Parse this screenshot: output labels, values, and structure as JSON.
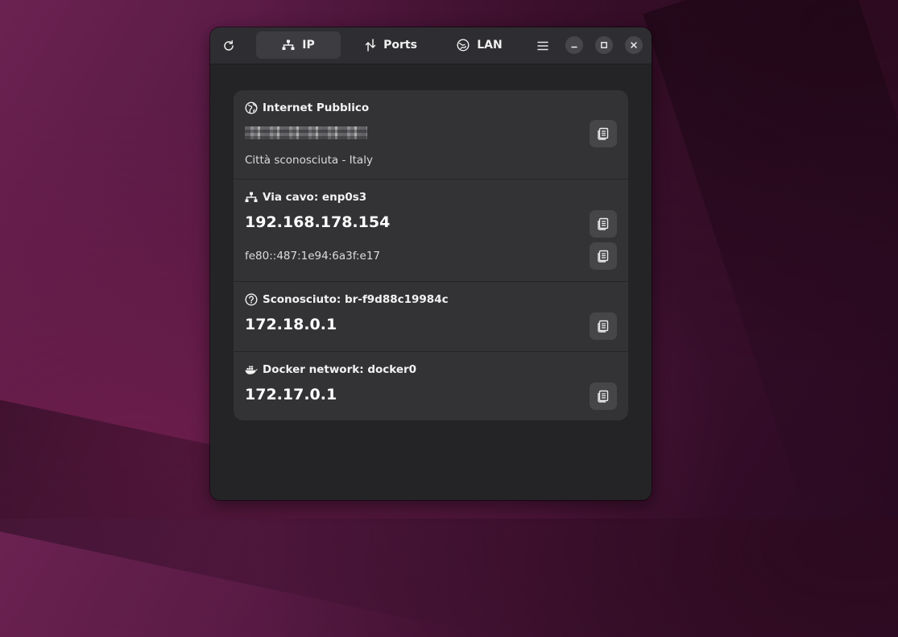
{
  "header": {
    "tabs": [
      {
        "label": "IP",
        "icon": "network-wired-icon",
        "active": true
      },
      {
        "label": "Ports",
        "icon": "ports-arrows-icon",
        "active": false
      },
      {
        "label": "LAN",
        "icon": "lan-globe-icon",
        "active": false
      }
    ]
  },
  "interfaces": [
    {
      "title": "Internet Pubblico",
      "icon": "globe-icon",
      "primary": "",
      "primary_redacted": true,
      "secondary": "Città sconosciuta - Italy"
    },
    {
      "title": "Via cavo: enp0s3",
      "icon": "network-wired-icon",
      "primary": "192.168.178.154",
      "secondary": "fe80::487:1e94:6a3f:e17"
    },
    {
      "title": "Sconosciuto: br-f9d88c19984c",
      "icon": "question-icon",
      "primary": "172.18.0.1"
    },
    {
      "title": "Docker network: docker0",
      "icon": "docker-whale-icon",
      "primary": "172.17.0.1"
    }
  ],
  "colors": {
    "window_bg": "#242426",
    "card_bg": "#333336",
    "button_bg": "#464649",
    "active_tab": "#3c3c41"
  }
}
